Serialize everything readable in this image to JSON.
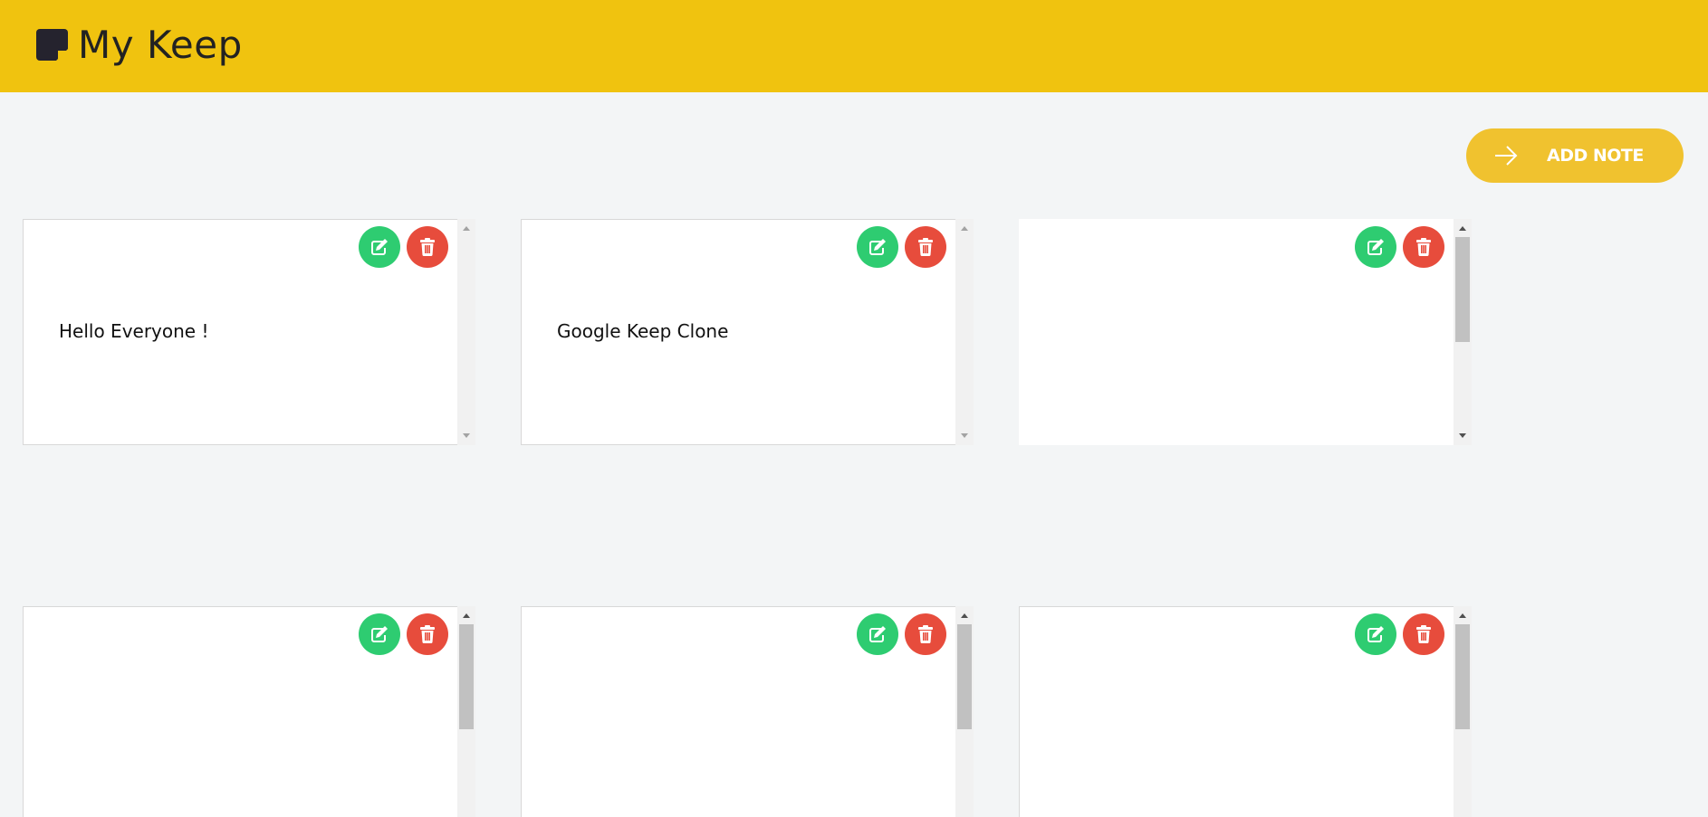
{
  "header": {
    "logo_icon": "sticky-note-icon",
    "title": "My Keep",
    "background": "#f0c30f"
  },
  "toolbar": {
    "add_note_label": "ADD NOTE",
    "add_note_icon": "arrow-right-icon",
    "accent": "#f0c22f"
  },
  "notes": [
    {
      "text": "Hello Everyone !",
      "edit_icon": "edit-icon",
      "delete_icon": "trash-icon"
    },
    {
      "text": "Google Keep Clone",
      "edit_icon": "edit-icon",
      "delete_icon": "trash-icon"
    },
    {
      "text": "",
      "edit_icon": "edit-icon",
      "delete_icon": "trash-icon"
    },
    {
      "text": "",
      "edit_icon": "edit-icon",
      "delete_icon": "trash-icon"
    },
    {
      "text": "",
      "edit_icon": "edit-icon",
      "delete_icon": "trash-icon"
    },
    {
      "text": "",
      "edit_icon": "edit-icon",
      "delete_icon": "trash-icon"
    }
  ],
  "colors": {
    "edit_button": "#2ecc71",
    "delete_button": "#e74c3c",
    "page_background": "#f3f5f6"
  }
}
